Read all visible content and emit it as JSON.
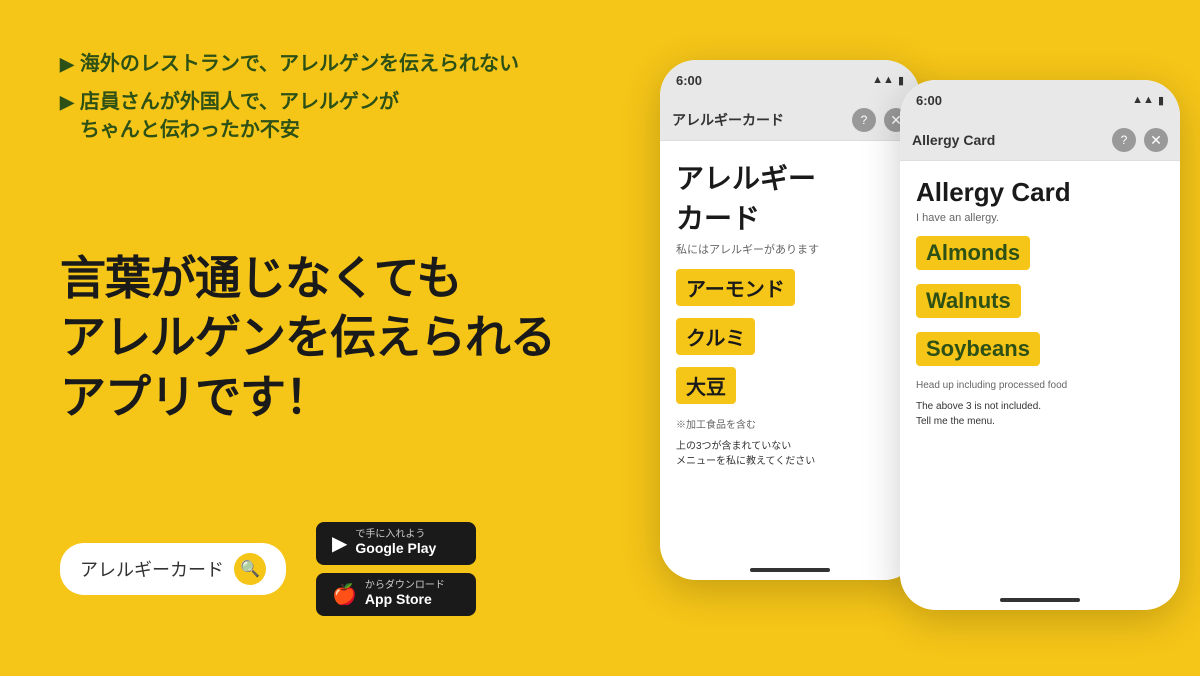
{
  "background_color": "#F5C518",
  "bullets": [
    {
      "text": "海外のレストランで、アレルゲンを伝えられない"
    },
    {
      "text": "店員さんが外国人で、アレルゲンが\nちゃんと伝わったか不安"
    }
  ],
  "headline": {
    "line1": "言葉が通じなくても",
    "line2": "アレルゲンを伝えられる",
    "line3": "アプリです！"
  },
  "search": {
    "placeholder": "アレルギーカード",
    "icon": "🔍"
  },
  "store_buttons": [
    {
      "label": "で手に入れよう",
      "name": "Google Play",
      "icon": "▶"
    },
    {
      "label": "からダウンロード",
      "name": "App Store",
      "icon": "🍎"
    }
  ],
  "phone_back": {
    "status_time": "6:00",
    "app_title": "アレルギー",
    "subtitle": "私にはアレルギーがあります",
    "allergens": [
      "アーモンド",
      "クルミ",
      "大豆"
    ],
    "note": "※加工食品を含む",
    "request": "上の3つが含まれていない\nメニューを私に教えてください"
  },
  "phone_front": {
    "status_time": "6:00",
    "app_title": "Allergy Card",
    "subtitle": "I have an allergy.",
    "allergens": [
      "Almonds",
      "Walnuts",
      "Soybeans"
    ],
    "note": "Head up including processed food",
    "request": "The above 3 is not included.\nTell me the menu."
  }
}
